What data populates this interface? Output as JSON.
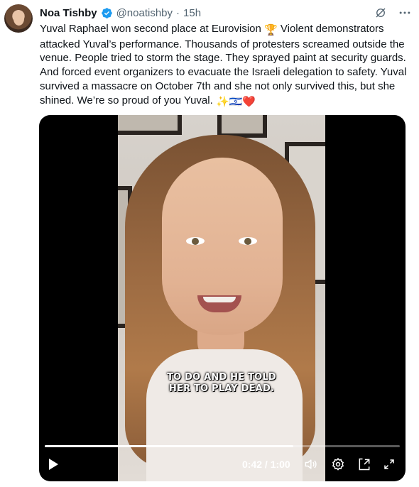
{
  "tweet": {
    "author_name": "Noa Tishby",
    "handle": "@noatishby",
    "separator": "·",
    "time": "15h",
    "text_part1": "Yuval Raphael won second place at Eurovision ",
    "text_part2": " Violent demonstrators attacked Yuval’s performance. Thousands of protesters screamed outside the venue. People tried to storm the stage. They sprayed paint at security guards. And forced event organizers to evacuate the Israeli delegation to safety. Yuval survived a massacre on October 7th and she not only survived this, but she shined. We’re so proud of you Yuval. ",
    "emoji_trophy": "🏆",
    "emoji_sparkles": "✨",
    "emoji_flag": "🇮🇱",
    "emoji_heart": "❤️"
  },
  "video": {
    "caption_line1": "TO DO AND HE TOLD",
    "caption_line2": "HER TO PLAY DEAD.",
    "time_display": "0:42 / 1:00",
    "progress_fraction": 0.7
  },
  "icons": {
    "verified": "verified-badge-icon",
    "grok": "grok-icon",
    "more": "more-icon",
    "play": "play-icon",
    "volume": "volume-icon",
    "settings": "settings-icon",
    "dock": "dock-icon",
    "fullscreen": "fullscreen-icon"
  },
  "colors": {
    "verified_blue": "#1d9bf0",
    "secondary_text": "#536471",
    "primary_text": "#0f1419"
  }
}
